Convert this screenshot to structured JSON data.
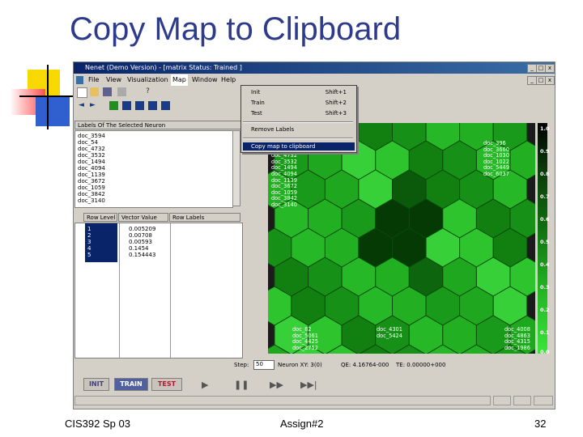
{
  "slide": {
    "title": "Copy Map to Clipboard",
    "footer_left": "CIS392 Sp 03",
    "footer_center": "Assign#2",
    "footer_right": "32"
  },
  "colors": {
    "title": "#2e3a8c",
    "accent_yellow": "#f7d800",
    "accent_red": "#ff5050",
    "accent_blue": "#3060d0"
  },
  "window": {
    "title": "Nenet (Demo Version) - [matrix   Status: Trained ]",
    "controls": [
      "_",
      "□",
      "x"
    ],
    "child_controls": [
      "_",
      "□",
      "x"
    ],
    "menu": [
      "File",
      "View",
      "Visualization",
      "Map",
      "Window",
      "Help"
    ]
  },
  "map_menu": {
    "items": [
      {
        "label": "Init",
        "shortcut": "Shift+1"
      },
      {
        "label": "Train",
        "shortcut": "Shift+2"
      },
      {
        "label": "Test",
        "shortcut": "Shift+3"
      },
      {
        "label": "Remove Labels",
        "shortcut": ""
      },
      {
        "label": "Copy map to clipboard",
        "shortcut": ""
      }
    ]
  },
  "labels_panel": {
    "header": "Labels Of The Selected Neuron",
    "items": [
      "doc_3594",
      "doc_54",
      "doc_4732",
      "doc_3532",
      "doc_1494",
      "doc_4094",
      "doc_1139",
      "doc_3672",
      "doc_1059",
      "doc_3842",
      "doc_3140"
    ]
  },
  "vector_table": {
    "columns": [
      "Row Level",
      "Vector Value",
      "Row Labels"
    ],
    "rows": [
      {
        "index": "1",
        "value": "0.005209"
      },
      {
        "index": "2",
        "value": "0.00708"
      },
      {
        "index": "3",
        "value": "0.00593"
      },
      {
        "index": "4",
        "value": "0.1454"
      },
      {
        "index": "5",
        "value": "0.154443"
      }
    ]
  },
  "map_labels": {
    "cluster_a": [
      "doc_3594",
      "doc_54",
      "doc_4732",
      "doc_3532",
      "doc_1494",
      "doc_4094",
      "doc_1139",
      "doc_3672",
      "doc_1059",
      "doc_3842",
      "doc_3140"
    ],
    "cluster_b": [
      "doc_396",
      "doc_3660",
      "doc_1030",
      "doc_1022",
      "doc_5449",
      "doc_6037"
    ],
    "cluster_c": [
      "doc_82",
      "doc_5061",
      "doc_4425",
      "doc_2752"
    ],
    "cluster_d": [
      "doc_4301",
      "doc_5424"
    ],
    "cluster_e": [
      "doc_4008",
      "doc_4863",
      "doc_4315",
      "doc_1986"
    ]
  },
  "colorbar": {
    "ticks": [
      "1.0",
      "0.9",
      "0.8",
      "0.7",
      "0.6",
      "0.5",
      "0.4",
      "0.3",
      "0.2",
      "0.1",
      "0.0"
    ]
  },
  "status_bar": {
    "step_label": "Step:",
    "step_value": "50",
    "neuron": "Neuron XY: 3(0)",
    "qe": "QE: 4.16764-000",
    "te": "TE: 0.00000+000"
  },
  "buttons": {
    "init": "INIT",
    "train": "TRAIN",
    "test": "TEST",
    "play": "▶",
    "pause": "❚❚",
    "forward": "▶▶",
    "end": "▶▶|"
  }
}
